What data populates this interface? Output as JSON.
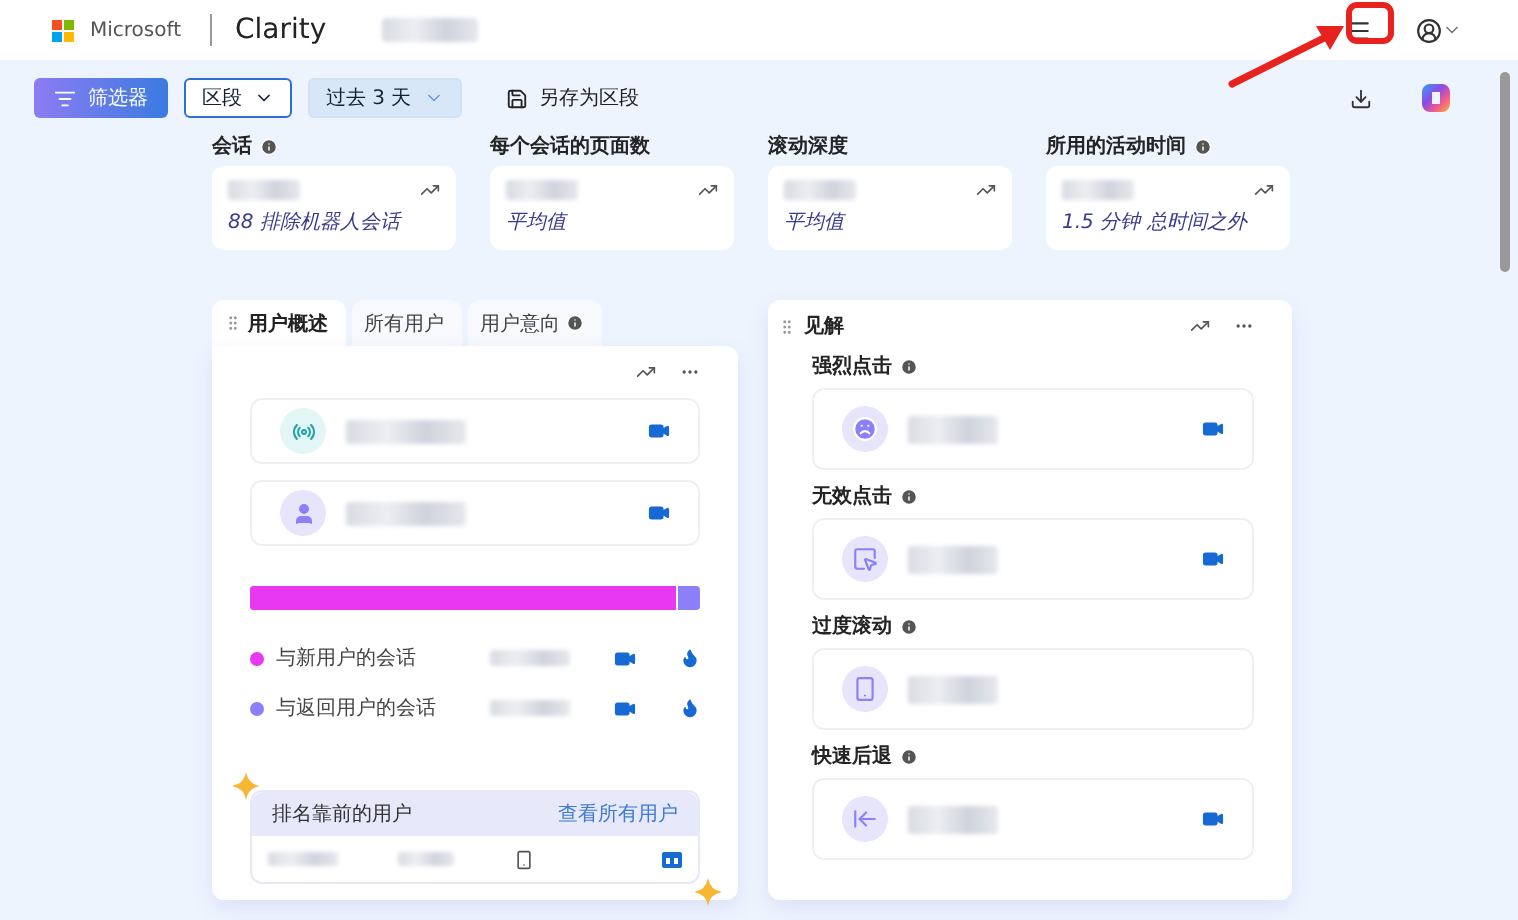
{
  "header": {
    "brand": "Microsoft",
    "product": "Clarity"
  },
  "toolbar": {
    "filter_button": "筛选器",
    "segment_dropdown": "区段",
    "date_dropdown": "过去 3 天",
    "save_button": "另存为区段"
  },
  "metrics": [
    {
      "label": "会话",
      "info": true,
      "note": "88 排除机器人会话"
    },
    {
      "label": "每个会话的页面数",
      "info": false,
      "note": "平均值"
    },
    {
      "label": "滚动深度",
      "info": false,
      "note": "平均值"
    },
    {
      "label": "所用的活动时间",
      "info": true,
      "note": "1.5 分钟 总时间之外"
    }
  ],
  "user_panel": {
    "tabs": [
      {
        "label": "用户概述",
        "selected": true,
        "info": false
      },
      {
        "label": "所有用户",
        "selected": false,
        "info": false
      },
      {
        "label": "用户意向",
        "selected": false,
        "info": true
      }
    ],
    "rows": [
      {
        "kind": "live"
      },
      {
        "kind": "user"
      }
    ],
    "bar": {
      "level": 0.95
    },
    "legend": [
      {
        "label": "与新用户的会话",
        "color": "#e838f2"
      },
      {
        "label": "与返回用户的会话",
        "color": "#8b80f9"
      }
    ],
    "top_users": {
      "title": "排名靠前的用户",
      "link": "查看所有用户"
    }
  },
  "insights": {
    "title": "见解",
    "sections": [
      {
        "label": "强烈点击",
        "kind": "rage",
        "recording": true
      },
      {
        "label": "无效点击",
        "kind": "dead",
        "recording": true
      },
      {
        "label": "过度滚动",
        "kind": "scroll",
        "recording": false
      },
      {
        "label": "快速后退",
        "kind": "back",
        "recording": true
      }
    ]
  }
}
